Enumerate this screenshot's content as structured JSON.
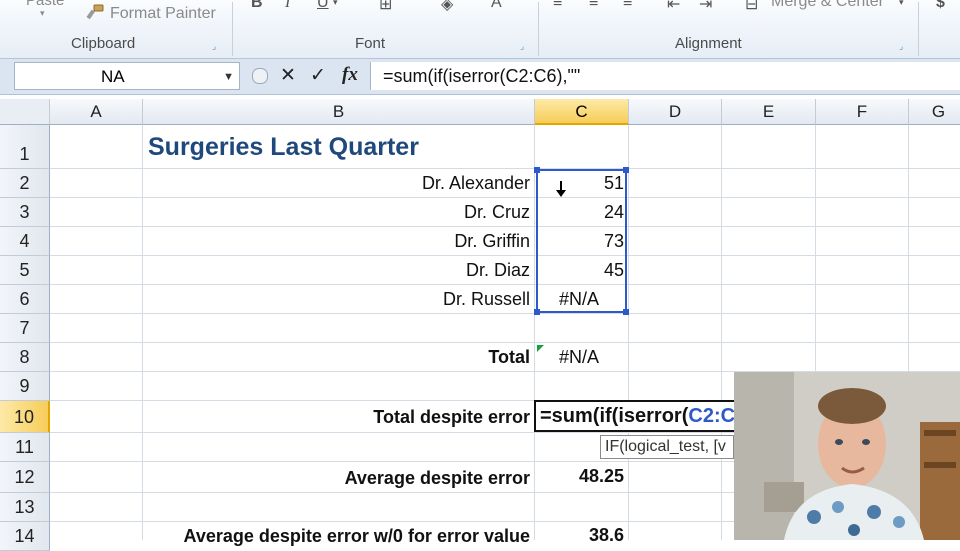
{
  "ribbon": {
    "paste_label": "Paste",
    "format_painter_label": "Format Painter",
    "clipboard_label": "Clipboard",
    "font_label": "Font",
    "alignment_label": "Alignment",
    "merge_center_label": "Merge & Center",
    "bold_glyph": "B",
    "italic_glyph": "I",
    "underline_glyph": "U",
    "currency_glyph": "$"
  },
  "formula_bar": {
    "name_box": "NA",
    "formula": "=sum(if(iserror(C2:C6),\"\"",
    "cancel_glyph": "✕",
    "enter_glyph": "✓",
    "fx_glyph": "fx"
  },
  "columns": [
    "A",
    "B",
    "C",
    "D",
    "E",
    "F",
    "G"
  ],
  "rows": [
    "1",
    "2",
    "3",
    "4",
    "5",
    "6",
    "7",
    "8",
    "9",
    "10",
    "11",
    "12",
    "13",
    "14"
  ],
  "cells": {
    "B1": "Surgeries Last Quarter",
    "B2": "Dr. Alexander",
    "C2": "51",
    "B3": "Dr. Cruz",
    "C3": "24",
    "B4": "Dr. Griffin",
    "C4": "73",
    "B5": "Dr. Diaz",
    "C5": "45",
    "B6": "Dr. Russell",
    "C6": "#N/A",
    "B8": "Total",
    "C8": "#N/A",
    "B10": "Total despite error",
    "C10_edit_prefix": "=sum(if(",
    "C10_edit_func": "iserror(",
    "C10_edit_ref": "C2:C",
    "C10_tooltip": "IF(logical_test, [v",
    "B12": "Average despite error",
    "C12": "48.25",
    "B14": "Average despite error w/0 for error value",
    "C14": "38.6"
  },
  "colors": {
    "accent_selection": "#2e59c9",
    "title": "#1f497d",
    "header_selected": "#f7cd59"
  },
  "icons": {
    "format_painter": "paintbrush-icon",
    "namebox_dropdown": "chevron-down-icon",
    "cursor": "down-arrow-cursor-icon"
  }
}
